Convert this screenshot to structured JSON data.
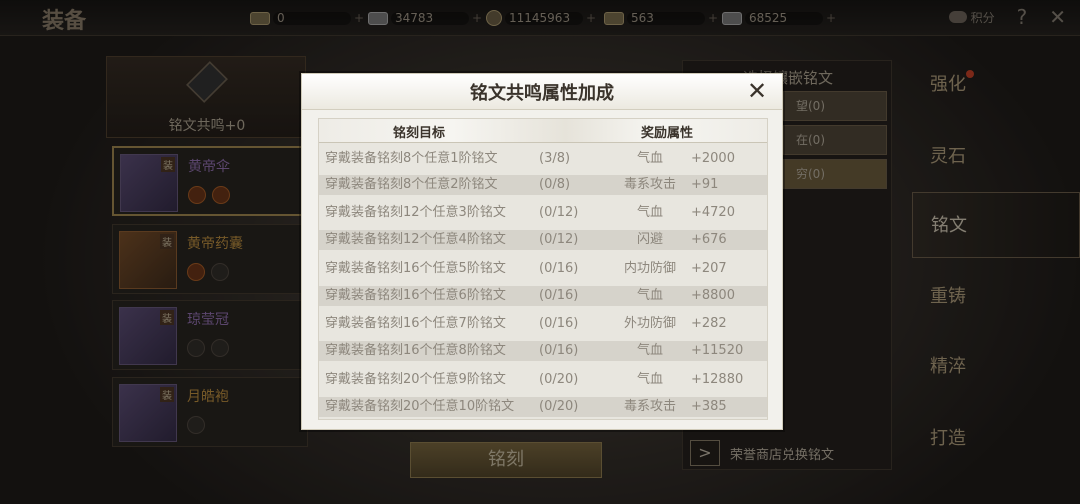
{
  "topbar": {
    "title": "装备",
    "currencies": [
      {
        "icon": "gold-ingot-icon",
        "value": "0"
      },
      {
        "icon": "silver-ingot-icon",
        "value": "34783"
      },
      {
        "icon": "coin-icon",
        "value": "11145963"
      },
      {
        "icon": "gold-bar-icon",
        "value": "563"
      },
      {
        "icon": "silver-bar-icon",
        "value": "68525"
      }
    ],
    "plus": "+",
    "score_label": "积分",
    "help": "?",
    "close": "✕"
  },
  "left": {
    "resonance_label": "铭文共鸣+0",
    "items": [
      {
        "name": "黄帝伞",
        "badge": "装"
      },
      {
        "name": "黄帝药囊",
        "badge": "装"
      },
      {
        "name": "琼莹冠",
        "badge": "装"
      },
      {
        "name": "月皓袍",
        "badge": "装"
      }
    ],
    "engrave_button": "铭刻"
  },
  "filter": {
    "title": "选择镶嵌铭文",
    "options": [
      "望(0)",
      "在(0)",
      "穷(0)"
    ],
    "exchange_label": "荣誉商店兑换铭文",
    "exchange_arrow": ">"
  },
  "tabs": [
    "强化",
    "灵石",
    "铭文",
    "重铸",
    "精淬",
    "打造"
  ],
  "modal": {
    "title": "铭文共鸣属性加成",
    "close": "✕",
    "header_target": "铭刻目标",
    "header_reward": "奖励属性",
    "rows": [
      {
        "target": "穿戴装备铭刻8个任意1阶铭文",
        "progress": "(3/8)",
        "attr": "气血",
        "value": "+2000"
      },
      {
        "target": "穿戴装备铭刻8个任意2阶铭文",
        "progress": "(0/8)",
        "attr": "毒系攻击",
        "value": "+91"
      },
      {
        "target": "穿戴装备铭刻12个任意3阶铭文",
        "progress": "(0/12)",
        "attr": "气血",
        "value": "+4720"
      },
      {
        "target": "穿戴装备铭刻12个任意4阶铭文",
        "progress": "(0/12)",
        "attr": "闪避",
        "value": "+676"
      },
      {
        "target": "穿戴装备铭刻16个任意5阶铭文",
        "progress": "(0/16)",
        "attr": "内功防御",
        "value": "+207"
      },
      {
        "target": "穿戴装备铭刻16个任意6阶铭文",
        "progress": "(0/16)",
        "attr": "气血",
        "value": "+8800"
      },
      {
        "target": "穿戴装备铭刻16个任意7阶铭文",
        "progress": "(0/16)",
        "attr": "外功防御",
        "value": "+282"
      },
      {
        "target": "穿戴装备铭刻16个任意8阶铭文",
        "progress": "(0/16)",
        "attr": "气血",
        "value": "+11520"
      },
      {
        "target": "穿戴装备铭刻20个任意9阶铭文",
        "progress": "(0/20)",
        "attr": "气血",
        "value": "+12880"
      },
      {
        "target": "穿戴装备铭刻20个任意10阶铭文",
        "progress": "(0/20)",
        "attr": "毒系攻击",
        "value": "+385"
      }
    ]
  }
}
